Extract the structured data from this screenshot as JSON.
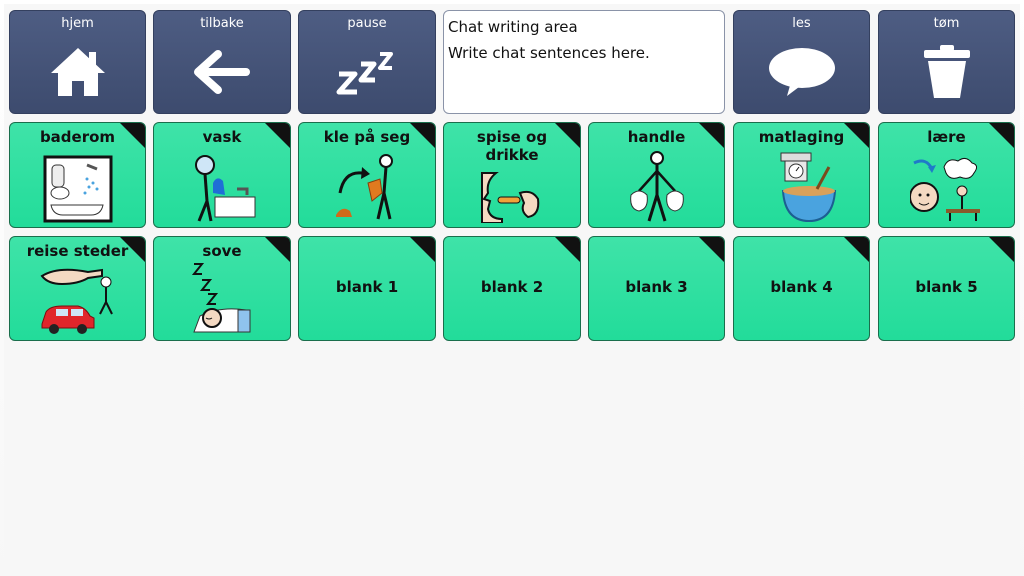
{
  "nav": {
    "home": {
      "label": "hjem",
      "icon": "home-icon"
    },
    "back": {
      "label": "tilbake",
      "icon": "arrow-left-icon"
    },
    "pause": {
      "label": "pause",
      "icon": "zzz-icon"
    },
    "read": {
      "label": "les",
      "icon": "speech-bubble-icon"
    },
    "clear": {
      "label": "tøm",
      "icon": "trash-icon"
    }
  },
  "chat": {
    "title": "Chat writing area",
    "placeholder": "Write chat sentences here."
  },
  "grid": {
    "row1": [
      {
        "label": "baderom",
        "icon": "bathroom-icon"
      },
      {
        "label": "vask",
        "icon": "washing-hands-icon"
      },
      {
        "label": "kle på seg",
        "icon": "getting-dressed-icon"
      },
      {
        "label": "spise og drikke",
        "icon": "eat-drink-icon"
      },
      {
        "label": "handle",
        "icon": "shopping-bags-icon"
      },
      {
        "label": "matlaging",
        "icon": "cooking-icon"
      },
      {
        "label": "lære",
        "icon": "learning-icon"
      }
    ],
    "row2": [
      {
        "label": "reise steder",
        "icon": "travel-icon"
      },
      {
        "label": "sove",
        "icon": "sleep-icon"
      },
      {
        "label": "blank 1"
      },
      {
        "label": "blank 2"
      },
      {
        "label": "blank 3"
      },
      {
        "label": "blank 4"
      },
      {
        "label": "blank 5"
      }
    ]
  },
  "colors": {
    "nav": "#46557a",
    "category": "#2ee0a0",
    "corner": "#111111"
  }
}
